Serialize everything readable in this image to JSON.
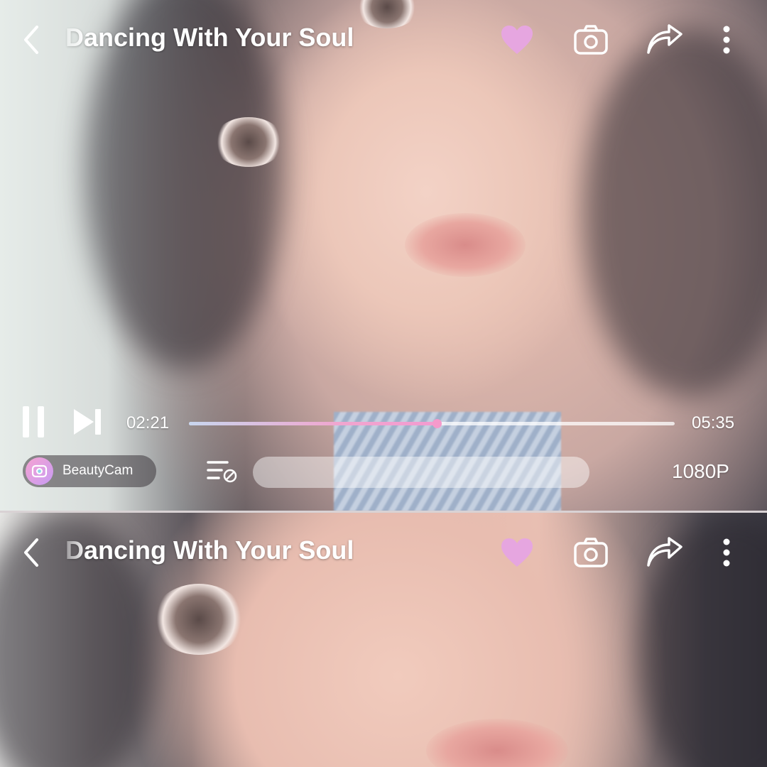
{
  "player": {
    "title": "Dancing With Your Soul",
    "progress_fraction": 0.51,
    "current_time": "02:21",
    "total_time": "05:35",
    "brand_label": "BeautyCam",
    "comment_placeholder": "",
    "quality": "1080P"
  },
  "icons": {
    "back": "chevron-left-icon",
    "favorite": "heart-icon",
    "camera": "camera-icon",
    "share": "share-icon",
    "more": "more-vertical-icon",
    "pause": "pause-icon",
    "next": "skip-next-icon",
    "playlist": "playlist-icon"
  },
  "colors": {
    "heart": "#e6a6e0",
    "progress_accent": "#f39bd0",
    "text": "#ffffff"
  }
}
